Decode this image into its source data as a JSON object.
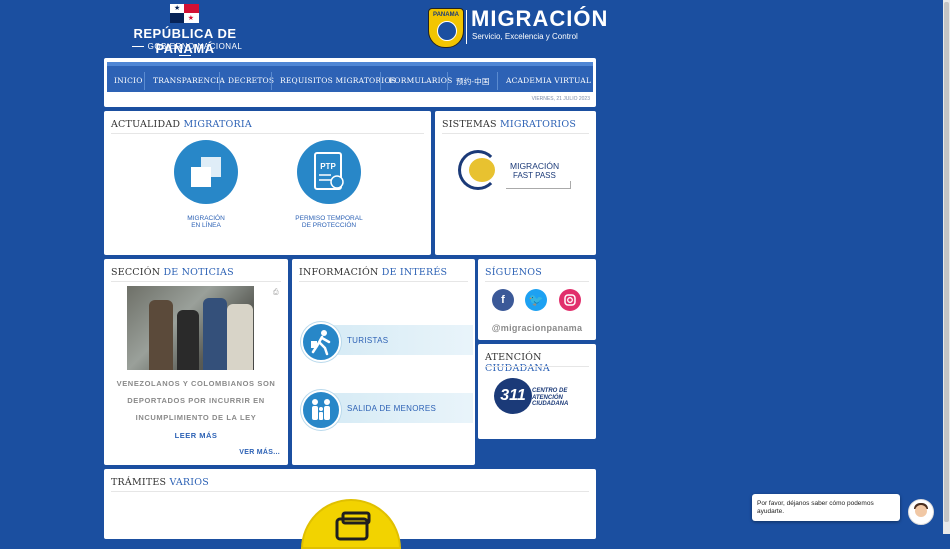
{
  "header": {
    "republic": "REPÚBLICA DE PANAMÁ",
    "government": "GOBIERNO NACIONAL",
    "shield_text": "PANAMA",
    "brand_title": "MIGRACIÓN",
    "brand_subtitle": "Servicio, Excelencia y Control"
  },
  "nav": {
    "items": [
      "INICIO",
      "TRANSPARENCIA",
      "DECRETOS",
      "REQUISITOS MIGRATORIOS",
      "FORMULARIOS",
      "预约-中国",
      "ACADEMIA VIRTUAL"
    ],
    "date": "VIERNES, 21 JULIO 2023"
  },
  "actualidad": {
    "title_dark": "ACTUALIDAD",
    "title_highlight": "MIGRATORIA",
    "links": [
      {
        "line1": "MIGRACIÓN",
        "line2": "EN LÍNEA",
        "icon": "squares-icon"
      },
      {
        "line1": "PERMISO TEMPORAL",
        "line2": "DE PROTECCIÓN",
        "icon": "ptp-document-icon",
        "icon_text": "PTP"
      }
    ]
  },
  "sistemas": {
    "title_dark": "SISTEMAS",
    "title_highlight": "MIGRATORIOS",
    "fastpass_line1": "MIGRACIÓN",
    "fastpass_line2": "FAST PASS"
  },
  "noticias": {
    "title_dark": "SECCIÓN",
    "title_highlight": "DE NOTICIAS",
    "headline_lines": [
      "VENEZOLANOS Y COLOMBIANOS SON",
      "DEPORTADOS POR INCURRIR EN",
      "INCUMPLIMIENTO DE LA LEY"
    ],
    "read_more": "LEER MÁS",
    "see_more": "VER MÁS..."
  },
  "interes": {
    "title_dark": "INFORMACIÓN",
    "title_highlight": "DE INTERÉS",
    "items": [
      "TURISTAS",
      "SALIDA DE MENORES"
    ]
  },
  "siguenos": {
    "title": "SÍGUENOS",
    "handle": "@migracionpanama",
    "colors": {
      "facebook": "#3b5998",
      "twitter": "#1da1f2",
      "instagram": "#e1306c"
    }
  },
  "atencion": {
    "title_dark": "ATENCIÓN",
    "title_highlight": "CIUDADANA",
    "number": "311",
    "center_lines": [
      "CENTRO DE",
      "ATENCIÓN",
      "CIUDADANA"
    ]
  },
  "tramites": {
    "title_dark": "TRÁMITES",
    "title_highlight": "VARIOS"
  },
  "chat": {
    "message": "Por favor, déjanos saber cómo podemos ayudarte."
  },
  "colors": {
    "background": "#1b4fa0",
    "accent": "#2d62b5",
    "icon_blue": "#2887c8",
    "gold": "#f2c500"
  }
}
